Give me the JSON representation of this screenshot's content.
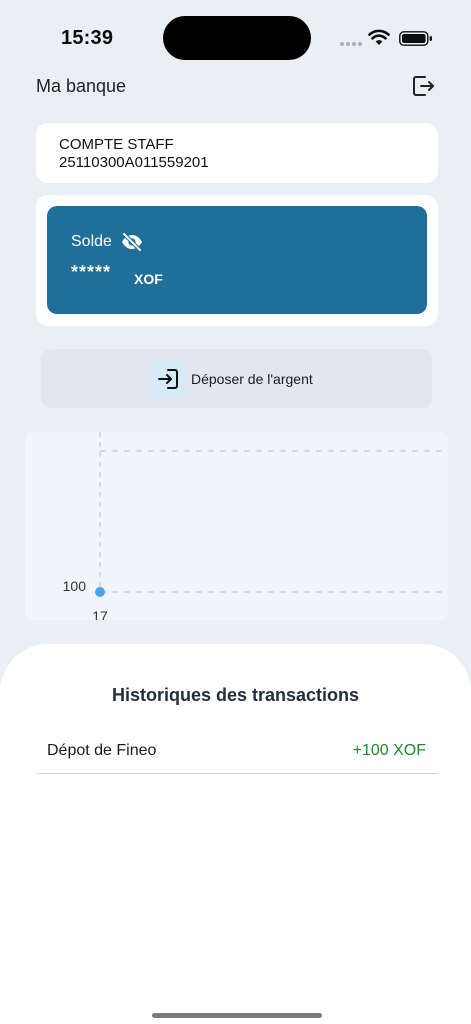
{
  "status_bar": {
    "time": "15:39"
  },
  "header": {
    "title": "Ma banque",
    "logout_icon": "logout-icon"
  },
  "account": {
    "name": "COMPTE STAFF",
    "number": "25110300A011559201"
  },
  "balance": {
    "label": "Solde",
    "masked_value": "*****",
    "currency": "XOF",
    "visibility_icon": "eye-off-icon"
  },
  "actions": {
    "deposit_label": "Déposer de l'argent",
    "deposit_icon": "login-arrow-icon"
  },
  "chart_data": {
    "type": "line",
    "x": [
      17
    ],
    "values": [
      100
    ],
    "x_tick_labels": [
      "17"
    ],
    "y_tick_labels": [
      "100"
    ],
    "grid": true
  },
  "history": {
    "title": "Historiques des transactions",
    "transactions": [
      {
        "label": "Dépot de Fineo",
        "amount": "+100 XOF"
      }
    ]
  },
  "colors": {
    "background": "#e9f0f5",
    "card_accent": "#206f9b",
    "credit": "#1f8a2e",
    "chart_point": "#4aa3ec"
  }
}
